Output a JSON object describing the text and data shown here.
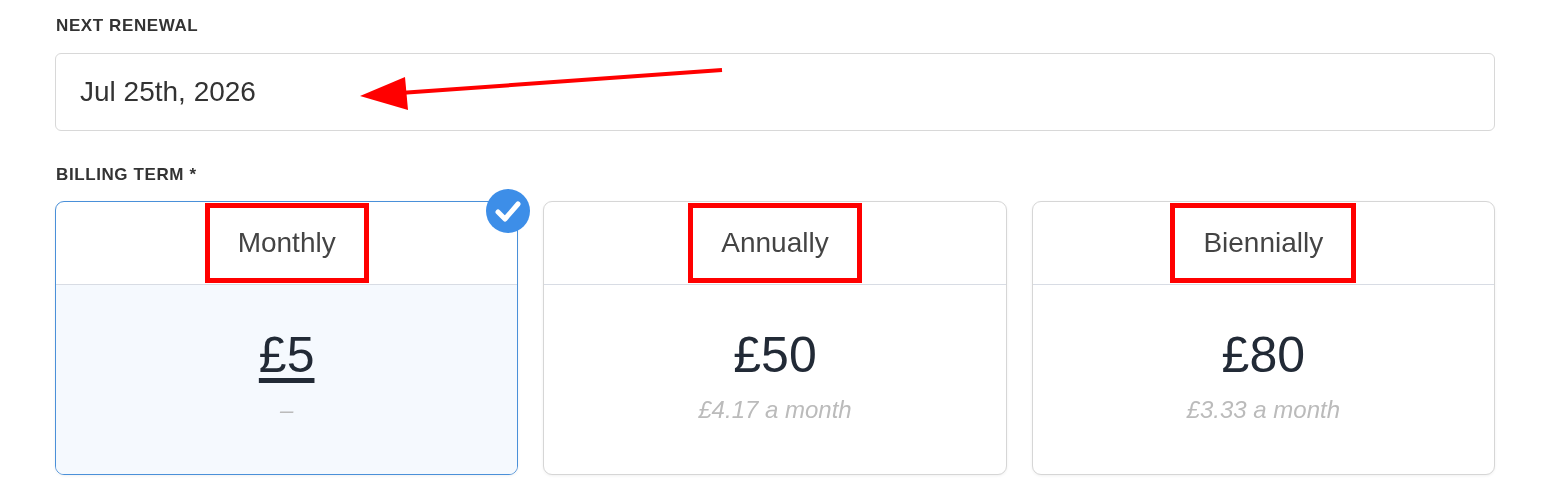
{
  "renewal": {
    "label": "NEXT RENEWAL",
    "value": "Jul 25th, 2026",
    "arrow": true
  },
  "billing": {
    "label": "BILLING TERM *",
    "terms": [
      {
        "name": "Monthly",
        "price": "£5",
        "note": "–",
        "selected": true,
        "highlighted": true
      },
      {
        "name": "Annually",
        "price": "£50",
        "note": "£4.17 a month",
        "selected": false,
        "highlighted": true
      },
      {
        "name": "Biennially",
        "price": "£80",
        "note": "£3.33 a month",
        "selected": false,
        "highlighted": true
      }
    ]
  }
}
